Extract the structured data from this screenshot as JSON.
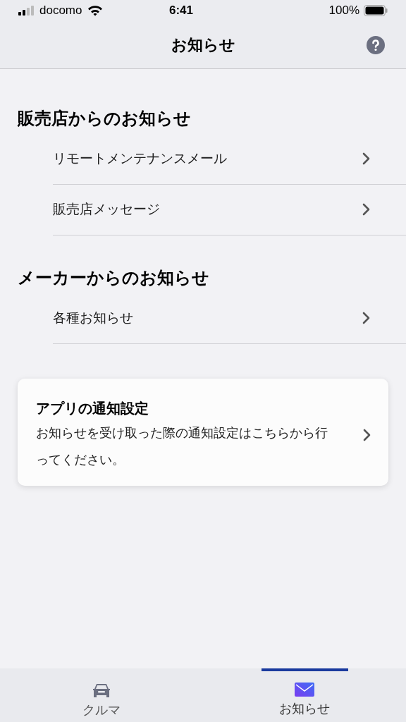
{
  "status_bar": {
    "carrier": "docomo",
    "time": "6:41",
    "battery": "100%"
  },
  "nav": {
    "title": "お知らせ"
  },
  "sections": [
    {
      "heading": "販売店からのお知らせ",
      "items": [
        {
          "label": "リモートメンテナンスメール"
        },
        {
          "label": "販売店メッセージ"
        }
      ]
    },
    {
      "heading": "メーカーからのお知らせ",
      "items": [
        {
          "label": "各種お知らせ"
        }
      ]
    }
  ],
  "card": {
    "title": "アプリの通知設定",
    "text": "お知らせを受け取った際の通知設定はこちらから行ってください。"
  },
  "tabs": [
    {
      "kind": "car",
      "label": "クルマ",
      "selected": false
    },
    {
      "kind": "mail",
      "label": "お知らせ",
      "selected": true
    }
  ]
}
